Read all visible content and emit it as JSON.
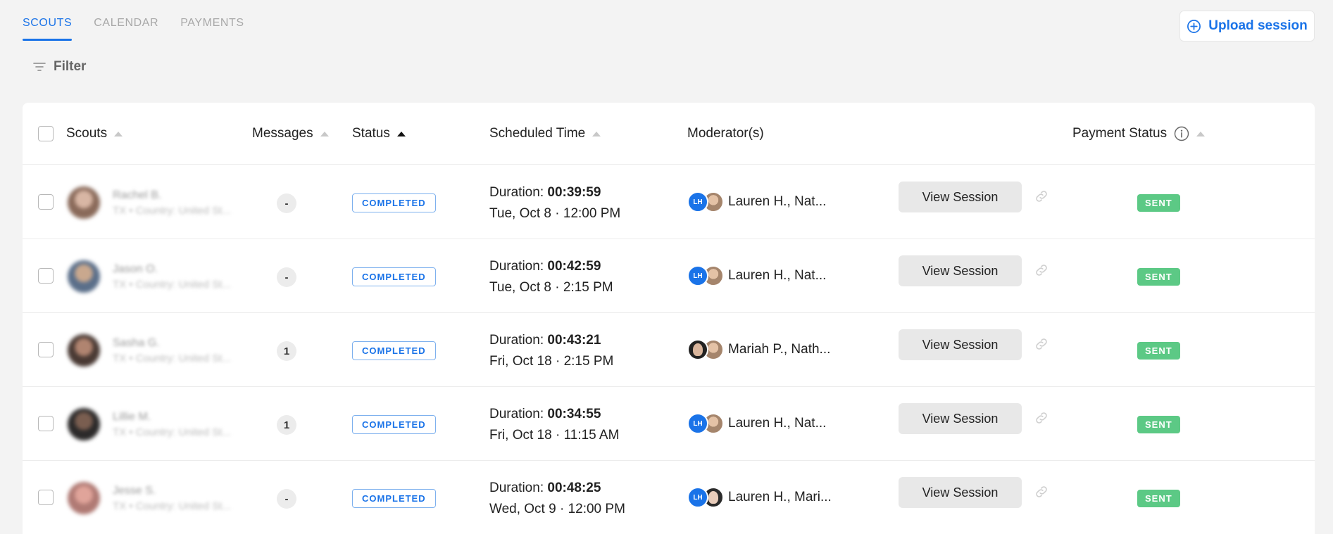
{
  "tabs": [
    {
      "label": "SCOUTS",
      "active": true
    },
    {
      "label": "CALENDAR",
      "active": false
    },
    {
      "label": "PAYMENTS",
      "active": false
    }
  ],
  "upload_button": {
    "label": "Upload session",
    "icon": "plus-circle-icon"
  },
  "filter": {
    "label": "Filter",
    "icon": "filter-lines-icon"
  },
  "table": {
    "columns": {
      "scouts": "Scouts",
      "messages": "Messages",
      "status": "Status",
      "scheduled_time": "Scheduled Time",
      "moderators": "Moderator(s)",
      "payment_status": "Payment Status"
    },
    "active_sort_column": "status",
    "rows": [
      {
        "scout_name": "Rachel B.",
        "scout_sub": "TX • Country: United St...",
        "messages": "-",
        "status": "COMPLETED",
        "duration_label": "Duration: ",
        "duration": "00:39:59",
        "date": "Tue, Oct 8 · 12:00 PM",
        "moderators": "Lauren H., Nat...",
        "mod1_initials": "LH",
        "view_label": "View Session",
        "payment": "SENT"
      },
      {
        "scout_name": "Jason O.",
        "scout_sub": "TX • Country: United St...",
        "messages": "-",
        "status": "COMPLETED",
        "duration_label": "Duration: ",
        "duration": "00:42:59",
        "date": "Tue, Oct 8 · 2:15 PM",
        "moderators": "Lauren H., Nat...",
        "mod1_initials": "LH",
        "view_label": "View Session",
        "payment": "SENT"
      },
      {
        "scout_name": "Sasha G.",
        "scout_sub": "TX • Country: United St...",
        "messages": "1",
        "status": "COMPLETED",
        "duration_label": "Duration: ",
        "duration": "00:43:21",
        "date": "Fri, Oct 18 · 2:15 PM",
        "moderators": "Mariah P., Nath...",
        "mod1_initials": "",
        "view_label": "View Session",
        "payment": "SENT"
      },
      {
        "scout_name": "Lillie M.",
        "scout_sub": "TX • Country: United St...",
        "messages": "1",
        "status": "COMPLETED",
        "duration_label": "Duration: ",
        "duration": "00:34:55",
        "date": "Fri, Oct 18 · 11:15 AM",
        "moderators": "Lauren H., Nat...",
        "mod1_initials": "LH",
        "view_label": "View Session",
        "payment": "SENT"
      },
      {
        "scout_name": "Jesse S.",
        "scout_sub": "TX • Country: United St...",
        "messages": "-",
        "status": "COMPLETED",
        "duration_label": "Duration: ",
        "duration": "00:48:25",
        "date": "Wed, Oct 9 · 12:00 PM",
        "moderators": "Lauren H., Mari...",
        "mod1_initials": "LH",
        "view_label": "View Session",
        "payment": "SENT"
      }
    ]
  },
  "colors": {
    "accent": "#1a73e8",
    "sent_green": "#5cc985",
    "background": "#f3f3f3"
  }
}
